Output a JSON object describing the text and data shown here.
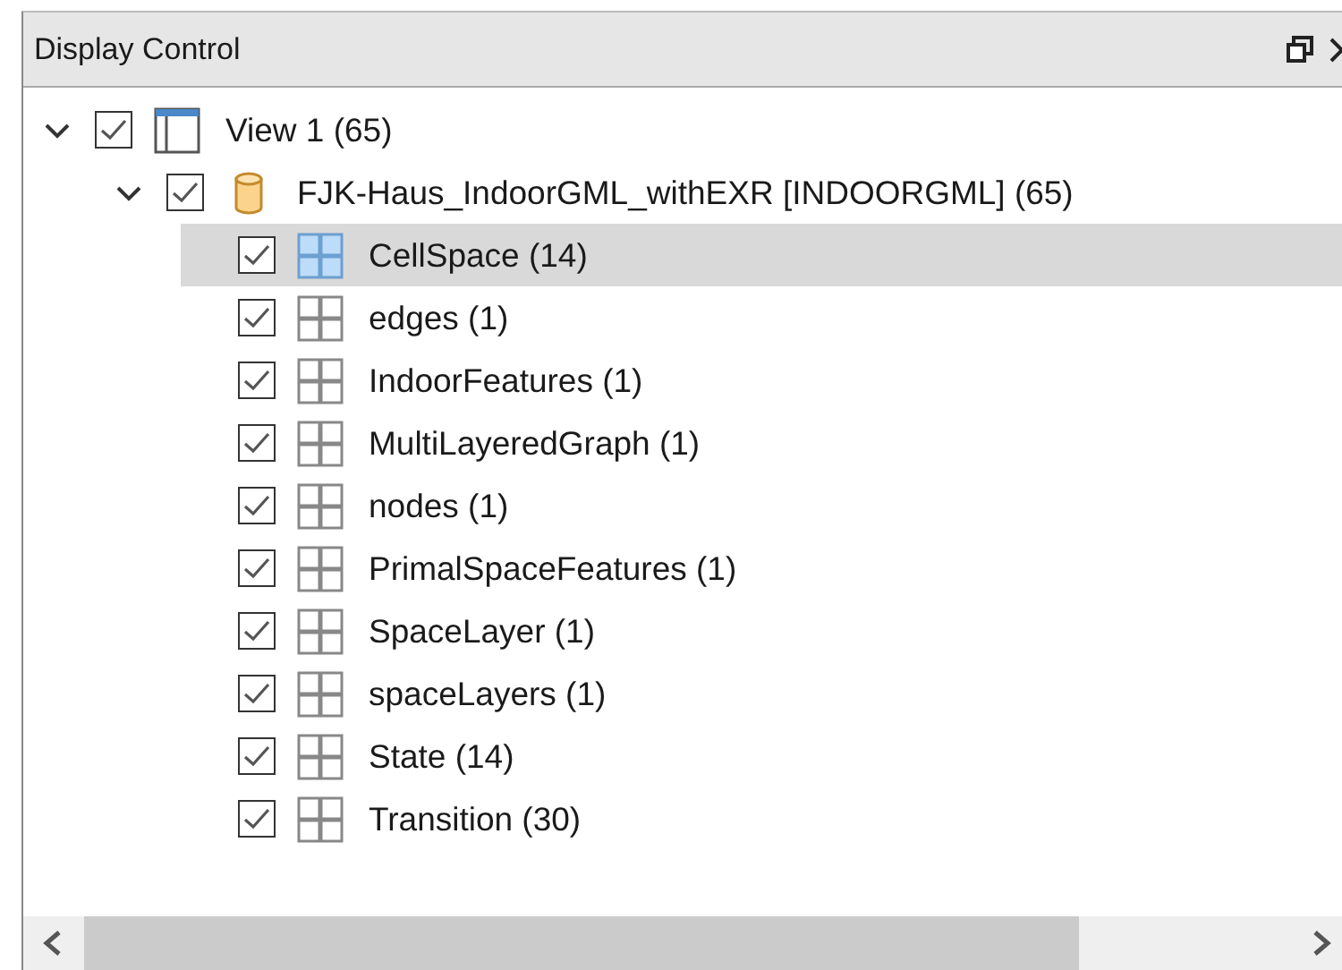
{
  "panel": {
    "title": "Display Control"
  },
  "tree": [
    {
      "label": "View 1 (65)",
      "kind": "view",
      "checked": true,
      "expanded": true,
      "selected": false,
      "children": [
        {
          "label": "FJK-Haus_IndoorGML_withEXR [INDOORGML] (65)",
          "kind": "dataset",
          "checked": true,
          "expanded": true,
          "selected": false,
          "children": [
            {
              "label": "CellSpace (14)",
              "kind": "layer",
              "checked": true,
              "selected": true
            },
            {
              "label": "edges (1)",
              "kind": "layer",
              "checked": true,
              "selected": false
            },
            {
              "label": "IndoorFeatures (1)",
              "kind": "layer",
              "checked": true,
              "selected": false
            },
            {
              "label": "MultiLayeredGraph (1)",
              "kind": "layer",
              "checked": true,
              "selected": false
            },
            {
              "label": "nodes (1)",
              "kind": "layer",
              "checked": true,
              "selected": false
            },
            {
              "label": "PrimalSpaceFeatures (1)",
              "kind": "layer",
              "checked": true,
              "selected": false
            },
            {
              "label": "SpaceLayer (1)",
              "kind": "layer",
              "checked": true,
              "selected": false
            },
            {
              "label": "spaceLayers (1)",
              "kind": "layer",
              "checked": true,
              "selected": false
            },
            {
              "label": "State (14)",
              "kind": "layer",
              "checked": true,
              "selected": false
            },
            {
              "label": "Transition (30)",
              "kind": "layer",
              "checked": true,
              "selected": false
            }
          ]
        }
      ]
    }
  ]
}
